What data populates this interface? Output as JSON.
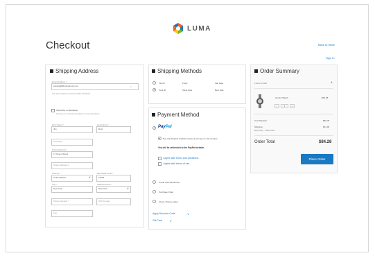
{
  "brand": {
    "name": "LUMA",
    "colors": [
      "#f26322",
      "#1979c3",
      "#7ab51d",
      "#ffc20e"
    ]
  },
  "page": {
    "title": "Checkout",
    "back_link": "Back to Store",
    "sign_in": "Sign In"
  },
  "shipping_address": {
    "title": "Shipping Address",
    "email_label": "Email Address *",
    "email_value": "sample@fdmchodouzu.me",
    "email_note": "You can create an account after checkout.",
    "newsletter_label": "Subscribe to Newsletter",
    "newsletter_note": "Check our monthly newsletter for special offers.",
    "first_name_label": "First Name *",
    "first_name": "Jim",
    "last_name_label": "Last Name *",
    "last_name": "Dow",
    "company_placeholder": "Company",
    "street_label": "Street Address *",
    "street_value": "17 Green Street",
    "street2_placeholder": "Street Address 2",
    "country_label": "Country *",
    "country": "United States",
    "zip_label": "Zip/Postal Code *",
    "zip": "10025",
    "city_label": "City *",
    "city": "New York",
    "state_label": "State/Province *",
    "state": "New York",
    "phone_placeholder": "Phone Number *",
    "vat_placeholder": "VAT Number",
    "fax_placeholder": "Fax"
  },
  "shipping_methods": {
    "title": "Shipping Methods",
    "rows": [
      {
        "price": "$0.00",
        "method": "Fixed",
        "carrier": "Flat Rate"
      },
      {
        "price": "$14.00",
        "method": "Table Rate",
        "carrier": "Best Way"
      }
    ]
  },
  "payment": {
    "title": "Payment Method",
    "paypal_main": "Pay",
    "paypal_accent": "Pal",
    "paypal_desc": "Pay with PayPal. PayPal Checkout will open in this window.",
    "redirect_note": "You will be redirected to the PayPal website.",
    "agree_terms": "I agree with terms and conditions",
    "agree_privacy": "I agree with terms of use",
    "other_methods": [
      "Credit Card (Braintree)",
      "Purchase Order",
      "Check / Money order"
    ],
    "discount_link": "Apply Discount Code",
    "gift_link": "Gift Card",
    "agree_link": "Terms and Conditions",
    "chev": "∨"
  },
  "order_summary": {
    "title": "Order Summary",
    "items_in_cart": "1 Item in Cart",
    "product_name": "Gemini Watch",
    "product_price": "$56.28",
    "qty_minus": "−",
    "qty": "1",
    "qty_plus": "+",
    "cart_subtotal_label": "Cart Subtotal",
    "cart_subtotal": "$56.28",
    "shipping_label": "Shipping",
    "shipping_sub": "Best Way - Table Rate",
    "shipping_value": "$14.00",
    "order_total_label": "Order Total",
    "order_total": "$84.28",
    "place_order": "Place Order",
    "collapse": "∧"
  }
}
